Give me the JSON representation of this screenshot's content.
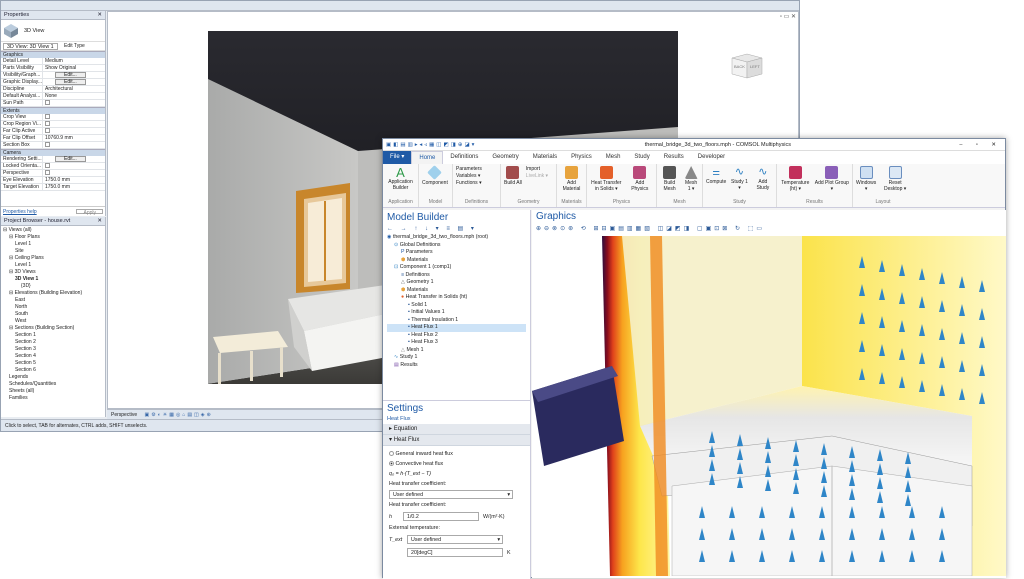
{
  "revit": {
    "properties_title": "Properties",
    "type_name": "3D View",
    "view_selector": "3D View: 3D View 1",
    "edit_type": "Edit Type",
    "groups": {
      "graphics": "Graphics",
      "extents": "Extents",
      "camera": "Camera"
    },
    "graphics_rows": [
      {
        "k": "Detail Level",
        "v": "Medium"
      },
      {
        "k": "Parts Visibility",
        "v": "Show Original"
      },
      {
        "k": "Visibility/Graph...",
        "v": "Edit..."
      },
      {
        "k": "Graphic Display...",
        "v": "Edit..."
      },
      {
        "k": "Discipline",
        "v": "Architectural"
      },
      {
        "k": "Default Analysi...",
        "v": "None"
      },
      {
        "k": "Sun Path",
        "v": ""
      }
    ],
    "extents_rows": [
      {
        "k": "Crop View",
        "v": ""
      },
      {
        "k": "Crop Region Vi...",
        "v": ""
      },
      {
        "k": "Far Clip Active",
        "v": ""
      },
      {
        "k": "Far Clip Offset",
        "v": "10760.9 mm"
      },
      {
        "k": "Section Box",
        "v": ""
      }
    ],
    "camera_rows": [
      {
        "k": "Rendering Setti...",
        "v": "Edit..."
      },
      {
        "k": "Locked Orienta...",
        "v": ""
      },
      {
        "k": "Perspective",
        "v": ""
      },
      {
        "k": "Eye Elevation",
        "v": "1750.0 mm"
      },
      {
        "k": "Target Elevation",
        "v": "1750.0 mm"
      }
    ],
    "properties_help": "Properties help",
    "apply": "Apply",
    "browser_title": "Project Browser - house.rvt",
    "tree": [
      "⊟ Views (all)",
      "⊟ Floor Plans",
      "Level 1",
      "Site",
      "⊟ Ceiling Plans",
      "Level 1",
      "⊟ 3D Views",
      "3D View 1",
      "{3D}",
      "⊟ Elevations (Building Elevation)",
      "East",
      "North",
      "South",
      "West",
      "⊟ Sections (Building Section)",
      "Section 1",
      "Section 2",
      "Section 3",
      "Section 4",
      "Section 5",
      "Section 6",
      "Legends",
      "Schedules/Quantities",
      "Sheets (all)",
      "Families"
    ],
    "viewcube_left": "BACK",
    "viewcube_right": "LEFT",
    "view_mode": "Perspective",
    "status": "Click to select, TAB for alternates, CTRL adds, SHIFT unselects."
  },
  "comsol": {
    "title": "thermal_bridge_3d_two_floors.mph - COMSOL Multiphysics",
    "tabs": [
      "File ▾",
      "Home",
      "Definitions",
      "Geometry",
      "Materials",
      "Physics",
      "Mesh",
      "Study",
      "Results",
      "Developer"
    ],
    "ribbon": {
      "application": {
        "btn": "Application Builder",
        "group": "Application"
      },
      "model": {
        "btn": "Component",
        "group": "Model"
      },
      "definitions": {
        "items": [
          "Parameters",
          "Variables ▾",
          "Functions ▾"
        ],
        "group": "Definitions"
      },
      "geometry": {
        "btn": "Build All",
        "items": [
          "Import",
          "LiveLink ▾"
        ],
        "group": "Geometry"
      },
      "materials": {
        "btn": "Add Material",
        "group": "Materials"
      },
      "physics": {
        "btn1": "Heat Transfer in Solids ▾",
        "btn2": "Add Physics",
        "group": "Physics"
      },
      "mesh": {
        "btn1": "Build Mesh",
        "btn2": "Mesh 1 ▾",
        "group": "Mesh"
      },
      "study": {
        "btn1": "Compute",
        "btn2": "Study 1 ▾",
        "btn3": "Add Study",
        "group": "Study"
      },
      "results": {
        "btn1": "Temperature (ht) ▾",
        "btn2": "Add Plot Group ▾",
        "group": "Results"
      },
      "layout": {
        "btn1": "Windows ▾",
        "btn2": "Reset Desktop ▾",
        "group": "Layout"
      }
    },
    "model_builder_title": "Model Builder",
    "model_tree": [
      {
        "t": "thermal_bridge_3d_two_floors.mph (root)",
        "l": 0
      },
      {
        "t": "Global Definitions",
        "l": 1
      },
      {
        "t": "Parameters",
        "l": 2
      },
      {
        "t": "Materials",
        "l": 2
      },
      {
        "t": "Component 1 (comp1)",
        "l": 1
      },
      {
        "t": "Definitions",
        "l": 2
      },
      {
        "t": "Geometry 1",
        "l": 2
      },
      {
        "t": "Materials",
        "l": 2
      },
      {
        "t": "Heat Transfer in Solids (ht)",
        "l": 2
      },
      {
        "t": "Solid 1",
        "l": 3
      },
      {
        "t": "Initial Values 1",
        "l": 3
      },
      {
        "t": "Thermal Insulation 1",
        "l": 3
      },
      {
        "t": "Heat Flux 1",
        "l": 3
      },
      {
        "t": "Heat Flux 2",
        "l": 3
      },
      {
        "t": "Heat Flux 3",
        "l": 3
      },
      {
        "t": "Mesh 1",
        "l": 2
      },
      {
        "t": "Study 1",
        "l": 1
      },
      {
        "t": "Results",
        "l": 1
      }
    ],
    "settings_title": "Settings",
    "settings_sub": "Heat Flux",
    "sec_equation": "Equation",
    "sec_heatflux": "Heat Flux",
    "opt_general": "General inward heat flux",
    "opt_convective": "Convective heat flux",
    "formula": "q₀ = h·(T_ext − T)",
    "htc_label": "Heat transfer coefficient:",
    "htc_select": "User defined",
    "htc_label2": "Heat transfer coefficient:",
    "h_symbol": "h",
    "h_value": "1/0.2",
    "h_unit": "W/(m²·K)",
    "ext_temp_label": "External temperature:",
    "text_symbol": "T_ext",
    "text_select": "User defined",
    "text_value": "20[degC]",
    "text_unit": "K",
    "graphics_title": "Graphics"
  }
}
